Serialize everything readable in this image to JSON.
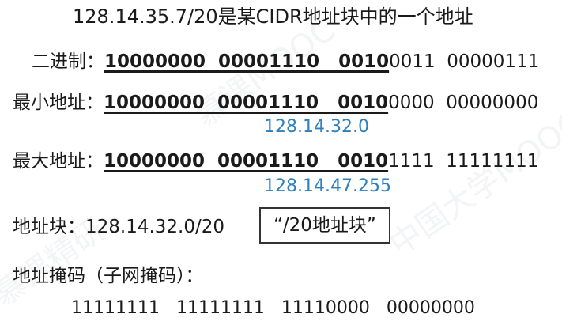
{
  "title": "128.14.35.7/20是某CIDR地址块中的一个地址",
  "binary": {
    "label": "二进制：",
    "bold_part": "10000000  00001110   0010",
    "plain_part": "0011  00000111"
  },
  "min_address": {
    "label": "最小地址：",
    "bold_part": "10000000  00001110   0010",
    "plain_part": "0000  00000000",
    "decimal": "128.14.32.0"
  },
  "max_address": {
    "label": "最大地址：",
    "bold_part": "10000000  00001110   0010",
    "plain_part": "1111  11111111",
    "decimal": "128.14.47.255"
  },
  "address_block": {
    "label": "地址块：128.14.32.0/20",
    "box_text": "“/20地址块”"
  },
  "mask": {
    "label": "地址掩码（子网掩码）：",
    "value": "11111111   11111111   11110000   00000000"
  }
}
